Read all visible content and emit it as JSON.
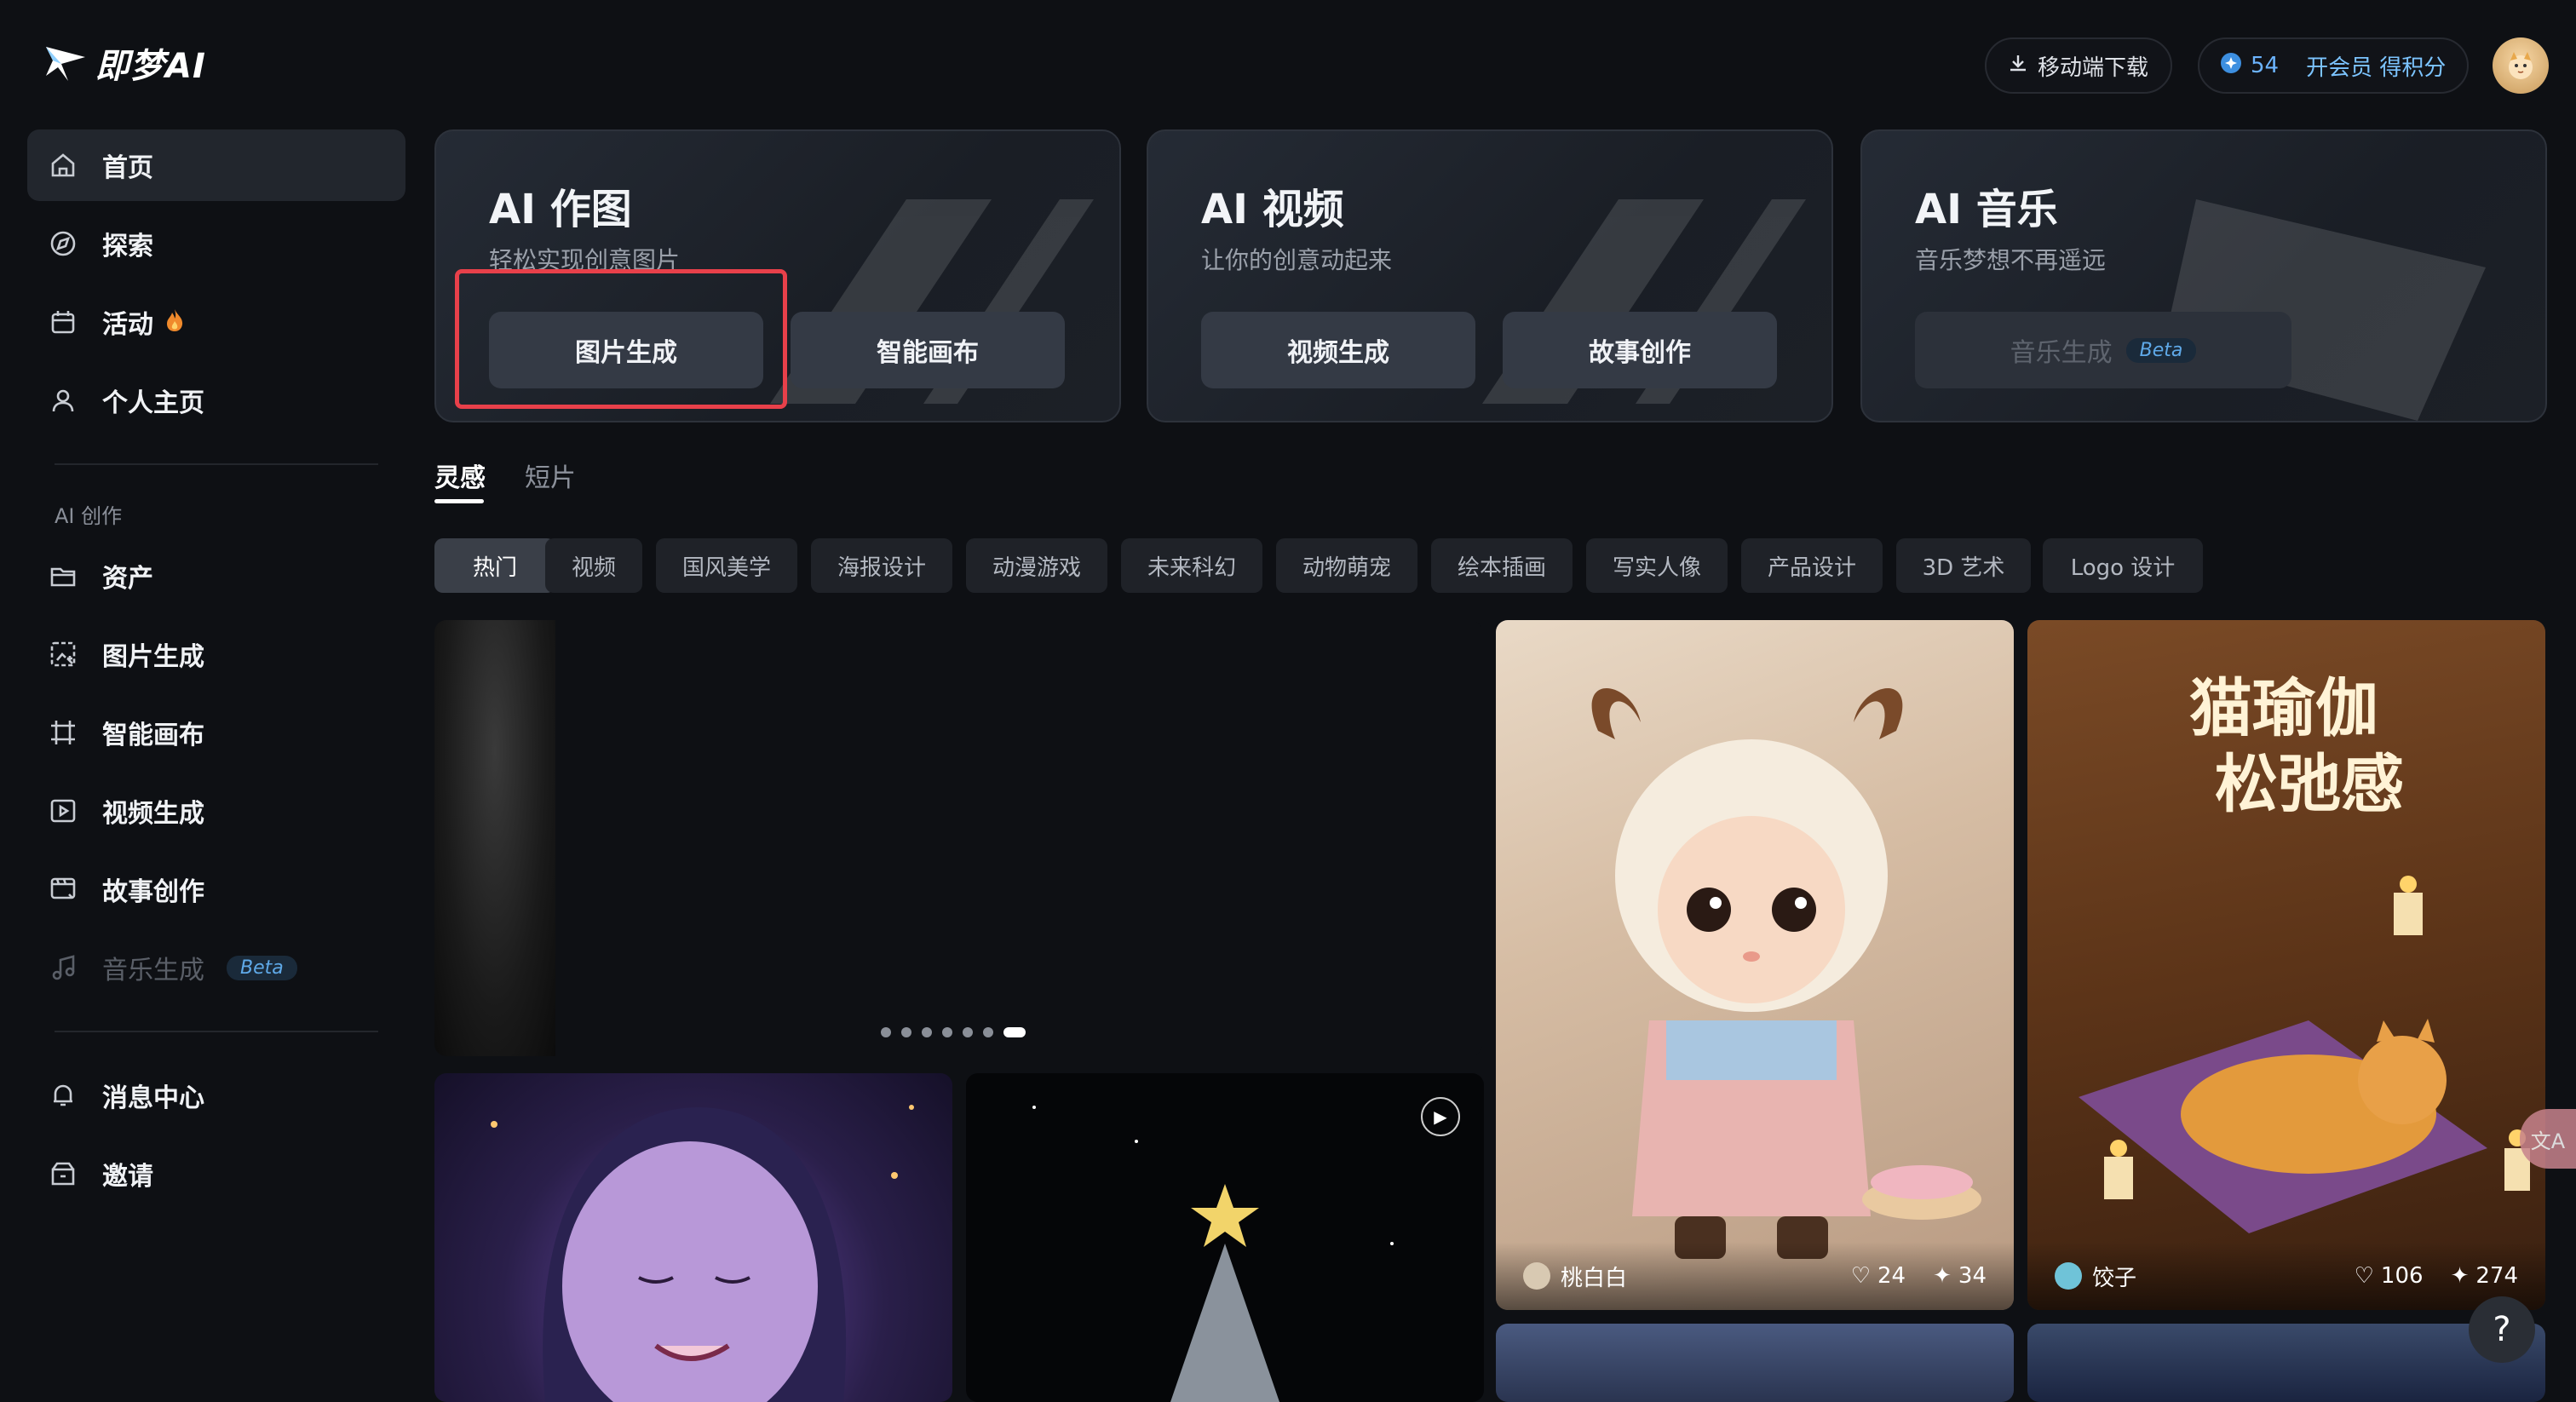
{
  "brand": {
    "logo_text": "即梦AI"
  },
  "sidebar": {
    "main_items": [
      {
        "label": "首页",
        "icon": "home-icon",
        "active": true
      },
      {
        "label": "探索",
        "icon": "compass-icon"
      },
      {
        "label": "活动",
        "icon": "event-icon",
        "badge": "fire-icon"
      },
      {
        "label": "个人主页",
        "icon": "user-icon"
      }
    ],
    "section_title": "AI 创作",
    "create_items": [
      {
        "label": "资产",
        "icon": "folder-icon"
      },
      {
        "label": "图片生成",
        "icon": "image-gen-icon"
      },
      {
        "label": "智能画布",
        "icon": "canvas-icon"
      },
      {
        "label": "视频生成",
        "icon": "video-gen-icon"
      },
      {
        "label": "故事创作",
        "icon": "story-icon"
      },
      {
        "label": "音乐生成",
        "icon": "music-icon",
        "badge": "Beta",
        "disabled": true
      }
    ],
    "bottom_items": [
      {
        "label": "消息中心",
        "icon": "bell-icon"
      },
      {
        "label": "邀请",
        "icon": "invite-icon"
      }
    ]
  },
  "topbar": {
    "download_label": "移动端下载",
    "points": "54",
    "vip_label": "开会员 得积分"
  },
  "cards": [
    {
      "title": "AI 作图",
      "subtitle": "轻松实现创意图片",
      "buttons": [
        "图片生成",
        "智能画布"
      ]
    },
    {
      "title": "AI 视频",
      "subtitle": "让你的创意动起来",
      "buttons": [
        "视频生成",
        "故事创作"
      ]
    },
    {
      "title": "AI 音乐",
      "subtitle": "音乐梦想不再遥远",
      "buttons": [
        "音乐生成"
      ],
      "button_badge": "Beta"
    }
  ],
  "tabs": [
    "灵感",
    "短片"
  ],
  "chips": [
    "热门",
    "视频",
    "国风美学",
    "海报设计",
    "动漫游戏",
    "未来科幻",
    "动物萌宠",
    "绘本插画",
    "写实人像",
    "产品设计",
    "3D 艺术",
    "Logo 设计"
  ],
  "feed": [
    {
      "author": "桃白白",
      "likes": "24",
      "remixes": "34"
    },
    {
      "author": "饺子",
      "likes": "106",
      "remixes": "274",
      "overlay_text_line1": "猫瑜伽",
      "overlay_text_line2": "松弛感"
    }
  ],
  "help_label": "?",
  "translate_label": "文A",
  "colors": {
    "accent": "#6cb4ff",
    "highlight": "#e8404a",
    "background": "#0e1014"
  }
}
